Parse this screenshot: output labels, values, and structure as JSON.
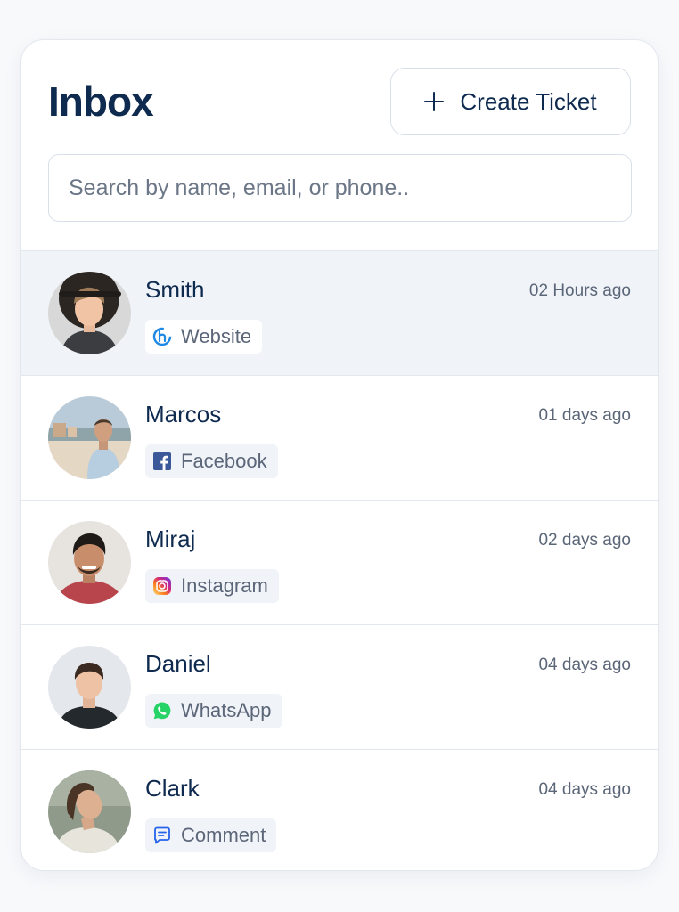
{
  "header": {
    "title": "Inbox",
    "create_button_label": "Create Ticket"
  },
  "search": {
    "placeholder": "Search by name, email, or phone.."
  },
  "conversations": [
    {
      "name": "Smith",
      "time": "02 Hours ago",
      "source": "Website",
      "source_icon": "website-icon",
      "active": true
    },
    {
      "name": "Marcos",
      "time": "01 days ago",
      "source": "Facebook",
      "source_icon": "facebook-icon",
      "active": false
    },
    {
      "name": "Miraj",
      "time": "02 days ago",
      "source": "Instagram",
      "source_icon": "instagram-icon",
      "active": false
    },
    {
      "name": "Daniel",
      "time": "04 days ago",
      "source": "WhatsApp",
      "source_icon": "whatsapp-icon",
      "active": false
    },
    {
      "name": "Clark",
      "time": "04 days ago",
      "source": "Comment",
      "source_icon": "comment-icon",
      "active": false
    }
  ],
  "colors": {
    "primary_text": "#0f2a4f",
    "secondary_text": "#5b6678",
    "active_row_bg": "#f0f3f8",
    "facebook": "#3b5998",
    "whatsapp": "#25d366",
    "website": "#1e88e5",
    "comment": "#2563eb"
  }
}
